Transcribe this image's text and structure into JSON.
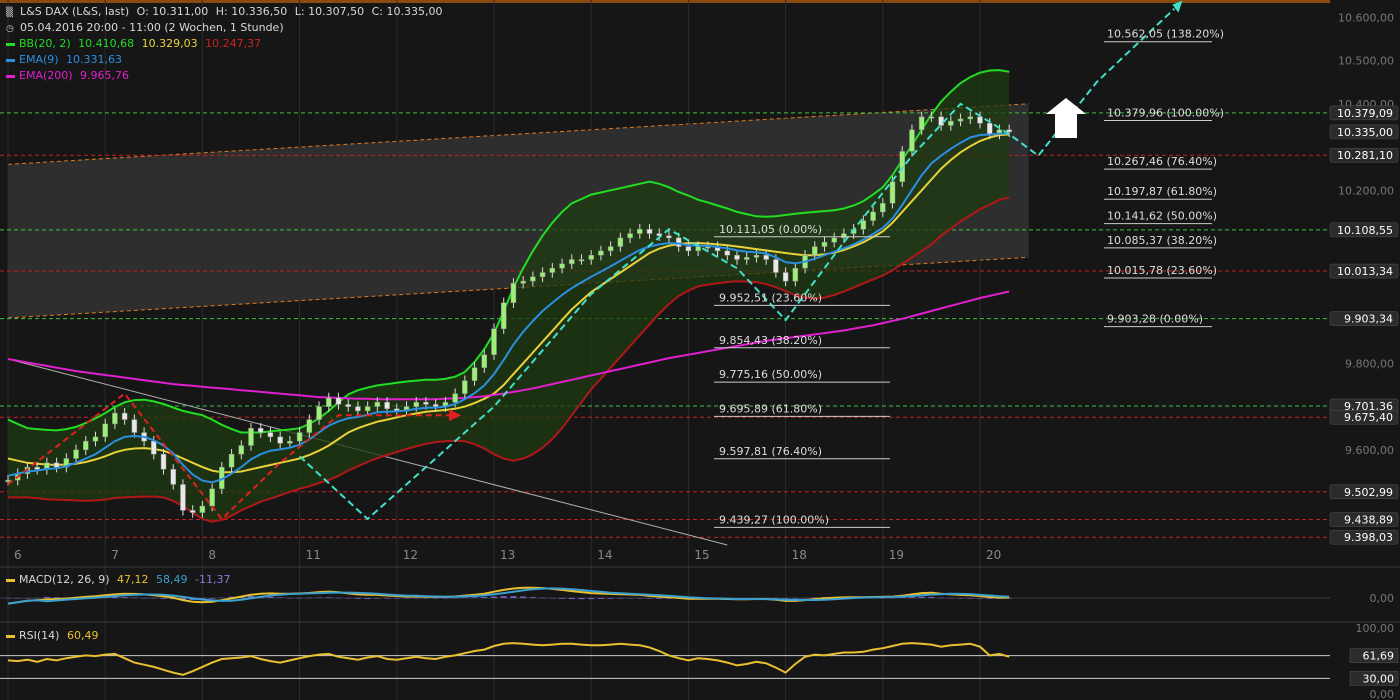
{
  "header": {
    "instrument": "L&S DAX (L&S, last)",
    "open": "O: 10.311,00",
    "high": "H: 10.336,50",
    "low": "L: 10.307,50",
    "close": "C: 10.335,00",
    "period": "05.04.2016 20:00 - 11:00 (2 Wochen, 1 Stunde)",
    "indicators": [
      {
        "name": "BB(20, 2)",
        "values": [
          "10.410,68",
          "10.329,03",
          "10.247,37"
        ],
        "colors": [
          "#22dd22",
          "#e8d23a",
          "#cc2222"
        ]
      },
      {
        "name": "EMA(9)",
        "values": [
          "10.331,63"
        ],
        "colors": [
          "#2a8fe0"
        ]
      },
      {
        "name": "EMA(200)",
        "values": [
          "9.965,76"
        ],
        "colors": [
          "#e020d0"
        ]
      }
    ]
  },
  "chart_data": {
    "type": "line",
    "title": "L&S DAX (L&S, last)",
    "xlabel": "",
    "ylabel": "",
    "ylim": [
      9380,
      10640
    ],
    "y_ticks": [
      "10.600,00",
      "10.500,00",
      "10.400,00",
      "10.200,00",
      "9.800,00",
      "9.600,00"
    ],
    "x_ticks": [
      "6",
      "7",
      "8",
      "11",
      "12",
      "13",
      "14",
      "15",
      "18",
      "19",
      "20"
    ],
    "x_tick_index": [
      0,
      10,
      20,
      30,
      40,
      50,
      60,
      70,
      80,
      90,
      100
    ],
    "price_labels": [
      {
        "text": "10.379,09",
        "value": 10379.09,
        "bg": "#2b2b2b"
      },
      {
        "text": "10.335,00",
        "value": 10335.0,
        "bg": "#2b2b2b"
      },
      {
        "text": "10.281,10",
        "value": 10281.1,
        "bg": "#2b2b2b"
      },
      {
        "text": "10.108,55",
        "value": 10108.55,
        "bg": "#2b2b2b"
      },
      {
        "text": "10.013,34",
        "value": 10013.34,
        "bg": "#2b2b2b"
      },
      {
        "text": "9.903,34",
        "value": 9903.34,
        "bg": "#2b2b2b"
      },
      {
        "text": "9.701,36",
        "value": 9701.36,
        "bg": "#2b2b2b"
      },
      {
        "text": "9.675,40",
        "value": 9675.4,
        "bg": "#2b2b2b"
      },
      {
        "text": "9.502,99",
        "value": 9502.99,
        "bg": "#2b2b2b"
      },
      {
        "text": "9.438,89",
        "value": 9438.89,
        "bg": "#2b2b2b"
      },
      {
        "text": "9.398,03",
        "value": 9398.03,
        "bg": "#2b2b2b"
      }
    ],
    "green_levels": [
      10379.09,
      10108.55,
      9903.34,
      9701.36
    ],
    "red_levels": [
      10281.1,
      10013.34,
      9675.4,
      9502.99,
      9438.89,
      9398.03
    ],
    "fib_upper": [
      {
        "text": "10.562,05 (138.20%)",
        "value": 10562.05
      },
      {
        "text": "10.379,96 (100.00%)",
        "value": 10379.96
      },
      {
        "text": "10.267,46 (76.40%)",
        "value": 10267.46
      },
      {
        "text": "10.197,87 (61.80%)",
        "value": 10197.87
      },
      {
        "text": "10.141,62 (50.00%)",
        "value": 10141.62
      },
      {
        "text": "10.085,37 (38.20%)",
        "value": 10085.37
      },
      {
        "text": "10.015,78 (23.60%)",
        "value": 10015.78
      },
      {
        "text": "9.903,28 (0.00%)",
        "value": 9903.28
      }
    ],
    "fib_lower": [
      {
        "text": "10.111,05 (0.00%)",
        "value": 10111.05
      },
      {
        "text": "9.952,51 (23.60%)",
        "value": 9952.51
      },
      {
        "text": "9.854,43 (38.20%)",
        "value": 9854.43
      },
      {
        "text": "9.775,16 (50.00%)",
        "value": 9775.16
      },
      {
        "text": "9.695,89 (61.80%)",
        "value": 9695.89
      },
      {
        "text": "9.597,81 (76.40%)",
        "value": 9597.81
      },
      {
        "text": "9.439,27 (100.00%)",
        "value": 9439.27
      }
    ],
    "channel": {
      "upper": [
        10260,
        10400
      ],
      "lower": [
        9905,
        10045
      ],
      "x": [
        0,
        105
      ]
    },
    "trendline": {
      "x": [
        0,
        74
      ],
      "y": [
        9810,
        9380
      ]
    },
    "zigzag_cyan": {
      "x": [
        30,
        37,
        50,
        60,
        68,
        75,
        80,
        86,
        93,
        98,
        103,
        106,
        112,
        120
      ],
      "y": [
        9585,
        9440,
        9700,
        9960,
        10110,
        10020,
        9900,
        10080,
        10280,
        10400,
        10330,
        10280,
        10450,
        10620
      ]
    },
    "zigzag_red": {
      "x": [
        0,
        12,
        22,
        28,
        34,
        46
      ],
      "y": [
        9520,
        9730,
        9440,
        9570,
        9680,
        9680
      ]
    },
    "close": [
      9530,
      9545,
      9560,
      9555,
      9570,
      9560,
      9580,
      9600,
      9620,
      9630,
      9660,
      9685,
      9670,
      9640,
      9620,
      9590,
      9555,
      9520,
      9460,
      9455,
      9470,
      9510,
      9560,
      9590,
      9610,
      9650,
      9640,
      9630,
      9615,
      9620,
      9640,
      9670,
      9700,
      9720,
      9705,
      9700,
      9690,
      9700,
      9710,
      9695,
      9690,
      9700,
      9710,
      9705,
      9700,
      9710,
      9730,
      9760,
      9790,
      9820,
      9880,
      9940,
      9985,
      9990,
      10000,
      10010,
      10020,
      10030,
      10040,
      10040,
      10050,
      10060,
      10070,
      10090,
      10100,
      10110,
      10100,
      10095,
      10090,
      10070,
      10060,
      10070,
      10070,
      10060,
      10050,
      10040,
      10045,
      10050,
      10040,
      10010,
      9990,
      10020,
      10050,
      10070,
      10080,
      10090,
      10100,
      10110,
      10130,
      10150,
      10170,
      10220,
      10290,
      10340,
      10370,
      10370,
      10350,
      10360,
      10365,
      10370,
      10355,
      10330,
      10340,
      10335
    ],
    "ema9": [
      9540,
      9545,
      9550,
      9552,
      9556,
      9557,
      9562,
      9570,
      9580,
      9590,
      9605,
      9620,
      9630,
      9632,
      9630,
      9622,
      9610,
      9592,
      9565,
      9543,
      9529,
      9525,
      9532,
      9545,
      9560,
      9578,
      9590,
      9598,
      9601,
      9605,
      9612,
      9624,
      9640,
      9656,
      9666,
      9673,
      9676,
      9681,
      9687,
      9688,
      9689,
      9691,
      9695,
      9697,
      9698,
      9700,
      9706,
      9717,
      9731,
      9749,
      9775,
      9808,
      9843,
      9873,
      9898,
      9921,
      9940,
      9958,
      9974,
      9987,
      10000,
      10012,
      10024,
      10037,
      10050,
      10062,
      10070,
      10075,
      10078,
      10077,
      10073,
      10072,
      10072,
      10069,
      10066,
      10061,
      10058,
      10057,
      10054,
      10045,
      10034,
      10031,
      10035,
      10042,
      10050,
      10058,
      10066,
      10075,
      10086,
      10099,
      10113,
      10135,
      10166,
      10201,
      10235,
      10262,
      10280,
      10296,
      10310,
      10322,
      10328,
      10329,
      10331,
      10332
    ],
    "bb_mid": [
      9580,
      9575,
      9570,
      9568,
      9566,
      9565,
      9566,
      9568,
      9572,
      9578,
      9585,
      9594,
      9600,
      9603,
      9604,
      9602,
      9598,
      9590,
      9580,
      9570,
      9560,
      9552,
      9548,
      9548,
      9550,
      9555,
      9560,
      9565,
      9570,
      9575,
      9580,
      9588,
      9598,
      9610,
      9625,
      9640,
      9650,
      9658,
      9665,
      9670,
      9675,
      9680,
      9684,
      9688,
      9690,
      9692,
      9695,
      9700,
      9708,
      9718,
      9730,
      9750,
      9775,
      9800,
      9825,
      9850,
      9875,
      9900,
      9925,
      9945,
      9965,
      9980,
      9995,
      10010,
      10025,
      10040,
      10055,
      10065,
      10072,
      10076,
      10078,
      10078,
      10077,
      10075,
      10073,
      10070,
      10067,
      10064,
      10061,
      10058,
      10055,
      10052,
      10050,
      10050,
      10052,
      10056,
      10062,
      10070,
      10080,
      10092,
      10105,
      10125,
      10150,
      10175,
      10200,
      10225,
      10250,
      10270,
      10288,
      10302,
      10314,
      10322,
      10328,
      10329
    ],
    "bb_width": [
      90,
      85,
      80,
      80,
      80,
      80,
      82,
      85,
      90,
      95,
      100,
      105,
      110,
      112,
      112,
      110,
      108,
      108,
      110,
      115,
      120,
      118,
      110,
      100,
      90,
      85,
      80,
      78,
      75,
      72,
      70,
      72,
      75,
      80,
      85,
      88,
      88,
      86,
      84,
      82,
      80,
      78,
      76,
      74,
      72,
      72,
      74,
      80,
      95,
      115,
      140,
      170,
      200,
      220,
      235,
      245,
      250,
      250,
      245,
      235,
      225,
      215,
      205,
      195,
      185,
      175,
      165,
      150,
      135,
      120,
      110,
      100,
      95,
      90,
      85,
      80,
      78,
      76,
      78,
      82,
      88,
      94,
      98,
      100,
      100,
      98,
      96,
      95,
      95,
      98,
      102,
      110,
      120,
      130,
      140,
      150,
      155,
      158,
      160,
      160,
      158,
      155,
      150,
      145
    ],
    "ema200": [
      9810,
      9806,
      9802,
      9798,
      9794,
      9790,
      9786,
      9782,
      9779,
      9776,
      9773,
      9770,
      9767,
      9764,
      9761,
      9758,
      9755,
      9752,
      9750,
      9748,
      9746,
      9744,
      9742,
      9740,
      9738,
      9736,
      9734,
      9732,
      9730,
      9728,
      9726,
      9724,
      9722,
      9721,
      9720,
      9719,
      9718,
      9718,
      9717,
      9717,
      9717,
      9717,
      9717,
      9717,
      9717,
      9718,
      9719,
      9720,
      9722,
      9724,
      9727,
      9730,
      9734,
      9738,
      9742,
      9747,
      9752,
      9757,
      9762,
      9767,
      9772,
      9777,
      9782,
      9787,
      9792,
      9797,
      9802,
      9807,
      9812,
      9816,
      9820,
      9824,
      9828,
      9832,
      9836,
      9840,
      9844,
      9848,
      9852,
      9855,
      9858,
      9861,
      9864,
      9867,
      9870,
      9873,
      9876,
      9880,
      9884,
      9888,
      9893,
      9898,
      9903,
      9909,
      9915,
      9921,
      9927,
      9933,
      9939,
      9945,
      9951,
      9956,
      9961,
      9966
    ],
    "macd": {
      "label": "MACD(12, 26, 9)",
      "values": [
        "47,12",
        "58,49",
        "-11,37"
      ],
      "colors": [
        "#e8c030",
        "#3aa0d0",
        "#8a7ad8"
      ],
      "zero_label": "0,00"
    },
    "rsi": {
      "label": "RSI(14)",
      "value": "60,49",
      "color": "#e8c030",
      "level_labels": [
        "100,00",
        "61,69",
        "30,00",
        "0,00"
      ],
      "values": [
        55,
        54,
        56,
        53,
        57,
        55,
        58,
        60,
        62,
        61,
        63,
        64,
        58,
        52,
        49,
        46,
        42,
        38,
        35,
        40,
        46,
        52,
        57,
        58,
        59,
        61,
        57,
        54,
        52,
        55,
        58,
        61,
        63,
        64,
        60,
        58,
        56,
        59,
        61,
        57,
        56,
        58,
        60,
        58,
        57,
        60,
        62,
        65,
        68,
        70,
        75,
        78,
        79,
        78,
        77,
        76,
        77,
        78,
        78,
        77,
        76,
        76,
        77,
        78,
        77,
        76,
        73,
        68,
        62,
        58,
        55,
        58,
        57,
        55,
        52,
        48,
        50,
        53,
        51,
        45,
        38,
        50,
        60,
        63,
        62,
        64,
        66,
        66,
        67,
        70,
        72,
        75,
        78,
        79,
        78,
        77,
        74,
        76,
        77,
        78,
        74,
        62,
        64,
        60
      ]
    }
  }
}
